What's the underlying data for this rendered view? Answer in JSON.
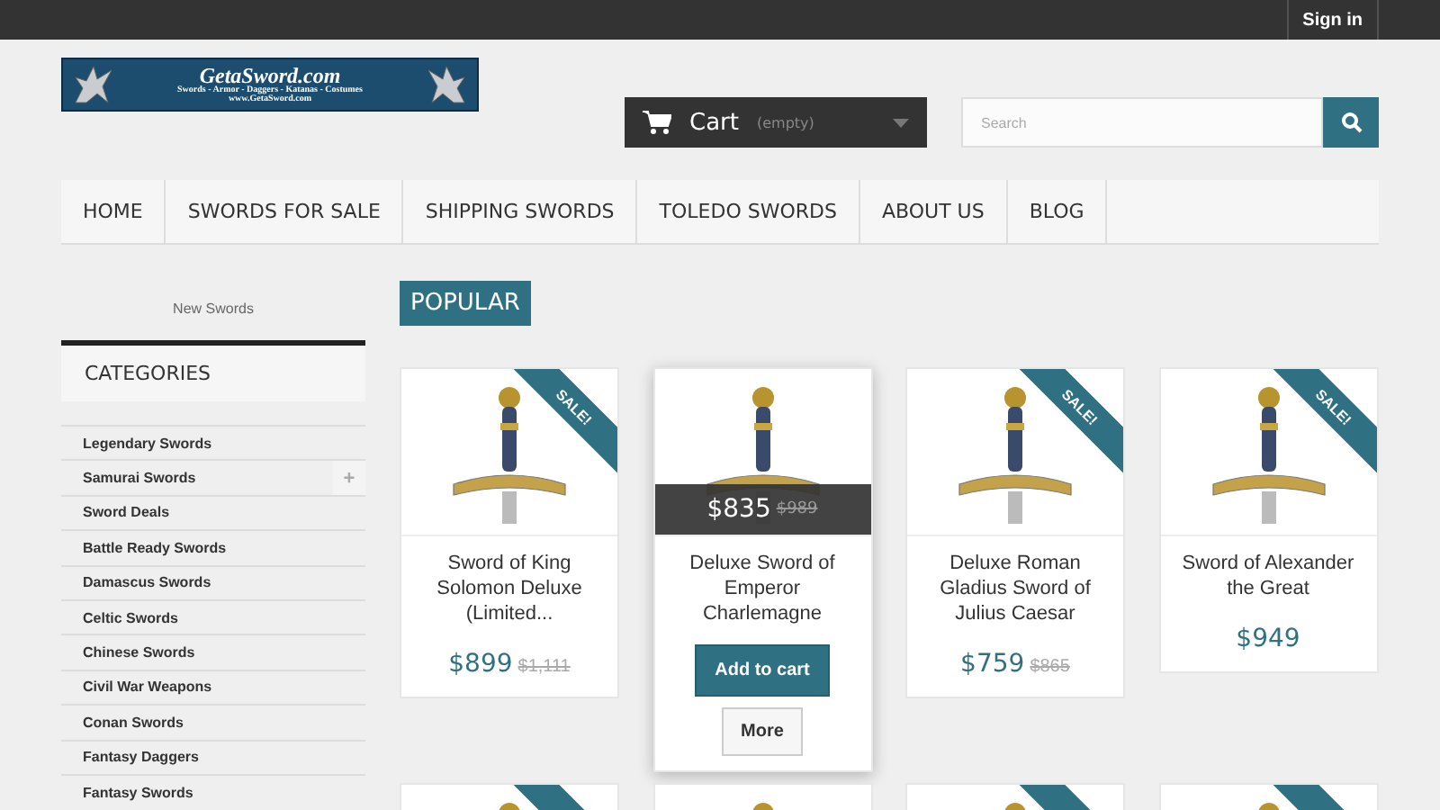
{
  "top_bar": {
    "sign_in": "Sign in"
  },
  "logo": {
    "title": "GetaSword.com",
    "tagline": "Swords - Armor - Daggers - Katanas - Costumes",
    "url": "www.GetaSword.com"
  },
  "cart": {
    "label": "Cart",
    "status": "(empty)"
  },
  "search": {
    "placeholder": "Search"
  },
  "nav": [
    "HOME",
    "SWORDS FOR SALE",
    "SHIPPING SWORDS",
    "TOLEDO SWORDS",
    "ABOUT US",
    "BLOG"
  ],
  "sidebar": {
    "link": "New Swords",
    "heading": "CATEGORIES",
    "items": [
      {
        "label": "Legendary Swords"
      },
      {
        "label": "Samurai Swords",
        "expand_symbol": "+"
      },
      {
        "label": "Sword Deals"
      },
      {
        "label": "Battle Ready Swords"
      },
      {
        "label": "Damascus Swords"
      },
      {
        "label": "Celtic Swords"
      },
      {
        "label": "Chinese Swords"
      },
      {
        "label": "Civil War Weapons"
      },
      {
        "label": "Conan Swords"
      },
      {
        "label": "Fantasy Daggers"
      },
      {
        "label": "Fantasy Swords"
      }
    ]
  },
  "section": {
    "title": "POPULAR"
  },
  "products": [
    {
      "name": "Sword of King Solomon Deluxe (Limited...",
      "price": "$899",
      "old_price": "$1,111",
      "sale": true,
      "sale_label": "SALE!",
      "hovered": false
    },
    {
      "name": "Deluxe Sword of Emperor Charlemagne",
      "price": "$835",
      "old_price": "$989",
      "sale": false,
      "hovered": true,
      "add_to_cart": "Add to cart",
      "more": "More"
    },
    {
      "name": "Deluxe Roman Gladius Sword of Julius Caesar",
      "price": "$759",
      "old_price": "$865",
      "sale": true,
      "sale_label": "SALE!",
      "hovered": false
    },
    {
      "name": "Sword of Alexander the Great",
      "price": "$949",
      "sale": true,
      "sale_label": "SALE!",
      "hovered": false
    }
  ],
  "next_row": [
    {
      "sale": true
    },
    {
      "sale": false
    },
    {
      "sale": true
    },
    {
      "sale": true
    }
  ]
}
